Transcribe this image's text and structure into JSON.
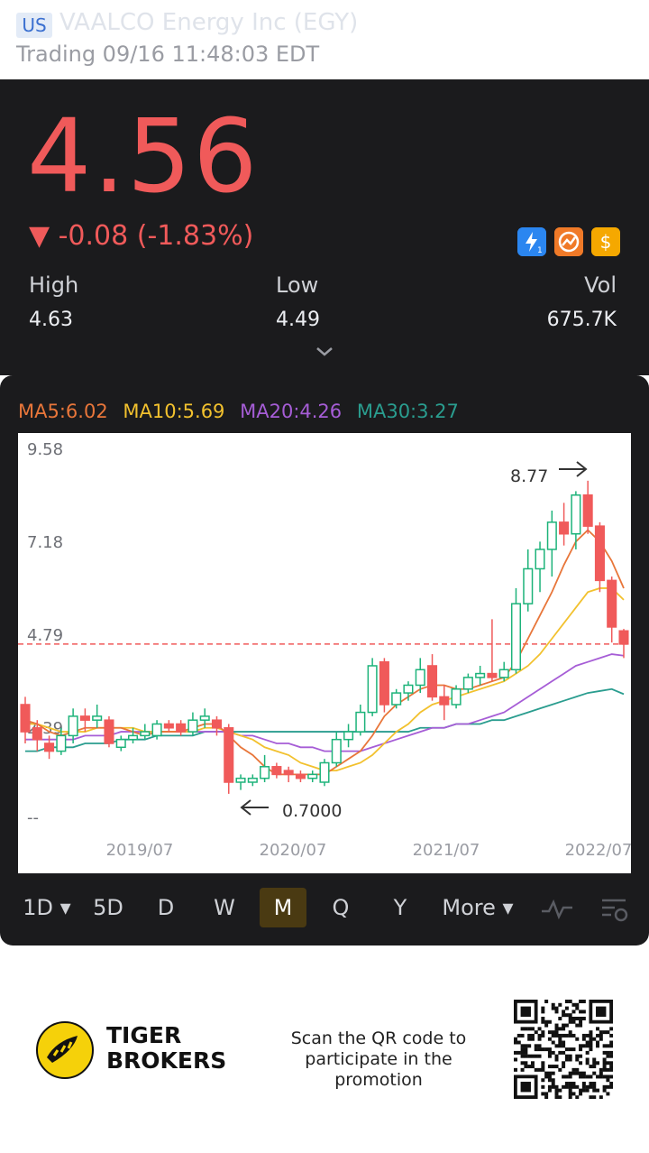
{
  "header": {
    "market_badge": "US",
    "title": "VAALCO Energy Inc (EGY)",
    "status": "Trading 09/16 11:48:03 EDT"
  },
  "quote": {
    "price": "4.56",
    "change": "▼ -0.08 (-1.83%)",
    "high_label": "High",
    "high_value": "4.63",
    "low_label": "Low",
    "low_value": "4.49",
    "vol_label": "Vol",
    "vol_value": "675.7K",
    "colors": {
      "down": "#f05a5a",
      "up": "#1db37a"
    }
  },
  "moving_averages": {
    "ma5": "MA5:6.02",
    "ma10": "MA10:5.69",
    "ma20": "MA20:4.26",
    "ma30": "MA30:3.27",
    "colors": {
      "ma5": "#e8763a",
      "ma10": "#f2c12e",
      "ma20": "#a65dd6",
      "ma30": "#2a9d8f"
    }
  },
  "chart_data": {
    "type": "candlestick",
    "y_ticks": [
      "9.58",
      "7.18",
      "4.79",
      "2.39",
      "--"
    ],
    "x_ticks": [
      "2019/07",
      "2020/07",
      "2021/07",
      "2022/07"
    ],
    "ylim": [
      0.0,
      9.58
    ],
    "current_price_line": 4.56,
    "annotations": {
      "high_label": "8.77",
      "low_label": "0.7000"
    },
    "candles": [
      {
        "o": 3.0,
        "h": 3.2,
        "l": 2.0,
        "c": 2.3
      },
      {
        "o": 2.4,
        "h": 2.6,
        "l": 1.8,
        "c": 2.1
      },
      {
        "o": 2.0,
        "h": 2.2,
        "l": 1.6,
        "c": 1.8
      },
      {
        "o": 1.8,
        "h": 2.4,
        "l": 1.7,
        "c": 2.2
      },
      {
        "o": 2.2,
        "h": 2.9,
        "l": 2.0,
        "c": 2.7
      },
      {
        "o": 2.7,
        "h": 2.9,
        "l": 2.3,
        "c": 2.6
      },
      {
        "o": 2.6,
        "h": 3.0,
        "l": 2.4,
        "c": 2.7
      },
      {
        "o": 2.6,
        "h": 2.7,
        "l": 1.9,
        "c": 2.0
      },
      {
        "o": 1.9,
        "h": 2.2,
        "l": 1.8,
        "c": 2.1
      },
      {
        "o": 2.1,
        "h": 2.4,
        "l": 2.0,
        "c": 2.2
      },
      {
        "o": 2.2,
        "h": 2.5,
        "l": 2.1,
        "c": 2.3
      },
      {
        "o": 2.2,
        "h": 2.6,
        "l": 2.1,
        "c": 2.5
      },
      {
        "o": 2.5,
        "h": 2.6,
        "l": 2.3,
        "c": 2.4
      },
      {
        "o": 2.5,
        "h": 2.6,
        "l": 2.2,
        "c": 2.3
      },
      {
        "o": 2.3,
        "h": 2.8,
        "l": 2.2,
        "c": 2.6
      },
      {
        "o": 2.6,
        "h": 2.9,
        "l": 2.4,
        "c": 2.7
      },
      {
        "o": 2.6,
        "h": 2.7,
        "l": 2.2,
        "c": 2.4
      },
      {
        "o": 2.4,
        "h": 2.5,
        "l": 0.7,
        "c": 1.0
      },
      {
        "o": 1.0,
        "h": 1.2,
        "l": 0.8,
        "c": 1.1
      },
      {
        "o": 1.0,
        "h": 1.2,
        "l": 0.9,
        "c": 1.1
      },
      {
        "o": 1.1,
        "h": 1.7,
        "l": 1.0,
        "c": 1.4
      },
      {
        "o": 1.4,
        "h": 1.5,
        "l": 1.1,
        "c": 1.2
      },
      {
        "o": 1.3,
        "h": 1.4,
        "l": 1.0,
        "c": 1.2
      },
      {
        "o": 1.2,
        "h": 1.3,
        "l": 1.0,
        "c": 1.1
      },
      {
        "o": 1.1,
        "h": 1.3,
        "l": 1.0,
        "c": 1.2
      },
      {
        "o": 1.0,
        "h": 1.6,
        "l": 0.9,
        "c": 1.5
      },
      {
        "o": 1.5,
        "h": 2.3,
        "l": 1.4,
        "c": 2.1
      },
      {
        "o": 2.1,
        "h": 2.5,
        "l": 1.9,
        "c": 2.3
      },
      {
        "o": 2.3,
        "h": 3.0,
        "l": 2.2,
        "c": 2.8
      },
      {
        "o": 2.8,
        "h": 4.2,
        "l": 2.7,
        "c": 4.0
      },
      {
        "o": 4.1,
        "h": 4.2,
        "l": 2.8,
        "c": 3.0
      },
      {
        "o": 3.0,
        "h": 3.4,
        "l": 2.9,
        "c": 3.3
      },
      {
        "o": 3.3,
        "h": 3.6,
        "l": 3.1,
        "c": 3.5
      },
      {
        "o": 3.5,
        "h": 4.2,
        "l": 3.3,
        "c": 3.9
      },
      {
        "o": 4.0,
        "h": 4.3,
        "l": 3.1,
        "c": 3.2
      },
      {
        "o": 3.2,
        "h": 3.5,
        "l": 2.6,
        "c": 3.0
      },
      {
        "o": 3.0,
        "h": 3.5,
        "l": 2.9,
        "c": 3.4
      },
      {
        "o": 3.4,
        "h": 3.8,
        "l": 3.3,
        "c": 3.7
      },
      {
        "o": 3.7,
        "h": 4.0,
        "l": 3.5,
        "c": 3.8
      },
      {
        "o": 3.8,
        "h": 5.2,
        "l": 3.6,
        "c": 3.7
      },
      {
        "o": 3.7,
        "h": 4.1,
        "l": 3.6,
        "c": 3.9
      },
      {
        "o": 3.9,
        "h": 6.0,
        "l": 3.8,
        "c": 5.6
      },
      {
        "o": 5.6,
        "h": 7.0,
        "l": 5.4,
        "c": 6.5
      },
      {
        "o": 6.5,
        "h": 7.2,
        "l": 5.9,
        "c": 7.0
      },
      {
        "o": 7.0,
        "h": 8.0,
        "l": 6.3,
        "c": 7.7
      },
      {
        "o": 7.7,
        "h": 8.2,
        "l": 7.1,
        "c": 7.4
      },
      {
        "o": 7.4,
        "h": 8.5,
        "l": 7.0,
        "c": 8.4
      },
      {
        "o": 8.4,
        "h": 8.77,
        "l": 7.4,
        "c": 7.6
      },
      {
        "o": 7.6,
        "h": 7.7,
        "l": 5.9,
        "c": 6.2
      },
      {
        "o": 6.2,
        "h": 6.3,
        "l": 4.6,
        "c": 5.0
      },
      {
        "o": 4.9,
        "h": 4.95,
        "l": 4.2,
        "c": 4.56
      }
    ],
    "ma5_values": [
      2.6,
      2.5,
      2.3,
      2.2,
      2.3,
      2.4,
      2.4,
      2.4,
      2.4,
      2.3,
      2.2,
      2.3,
      2.3,
      2.3,
      2.4,
      2.5,
      2.5,
      2.2,
      1.9,
      1.7,
      1.4,
      1.2,
      1.2,
      1.2,
      1.2,
      1.2,
      1.4,
      1.6,
      1.8,
      2.2,
      2.7,
      3.0,
      3.2,
      3.4,
      3.5,
      3.5,
      3.4,
      3.4,
      3.5,
      3.6,
      3.7,
      4.1,
      4.7,
      5.3,
      5.9,
      6.6,
      7.2,
      7.5,
      7.2,
      6.7,
      6.0
    ],
    "ma10_values": [
      2.5,
      2.5,
      2.4,
      2.3,
      2.3,
      2.3,
      2.4,
      2.4,
      2.4,
      2.4,
      2.3,
      2.3,
      2.3,
      2.3,
      2.3,
      2.4,
      2.4,
      2.3,
      2.2,
      2.1,
      1.9,
      1.8,
      1.7,
      1.5,
      1.4,
      1.3,
      1.3,
      1.4,
      1.5,
      1.7,
      2.0,
      2.3,
      2.5,
      2.8,
      3.0,
      3.1,
      3.2,
      3.3,
      3.4,
      3.5,
      3.6,
      3.8,
      4.0,
      4.3,
      4.7,
      5.1,
      5.5,
      5.9,
      6.0,
      6.0,
      5.7
    ],
    "ma20_values": [
      2.1,
      2.1,
      2.1,
      2.1,
      2.1,
      2.2,
      2.2,
      2.2,
      2.3,
      2.3,
      2.3,
      2.3,
      2.3,
      2.3,
      2.3,
      2.3,
      2.3,
      2.3,
      2.2,
      2.2,
      2.1,
      2.0,
      2.0,
      1.9,
      1.9,
      1.8,
      1.8,
      1.8,
      1.8,
      1.9,
      2.0,
      2.1,
      2.2,
      2.3,
      2.4,
      2.4,
      2.5,
      2.5,
      2.6,
      2.7,
      2.8,
      3.0,
      3.2,
      3.4,
      3.6,
      3.8,
      4.0,
      4.1,
      4.2,
      4.3,
      4.26
    ],
    "ma30_values": [
      1.8,
      1.8,
      1.9,
      1.9,
      1.9,
      2.0,
      2.0,
      2.0,
      2.1,
      2.1,
      2.1,
      2.2,
      2.2,
      2.2,
      2.2,
      2.3,
      2.3,
      2.3,
      2.3,
      2.3,
      2.3,
      2.3,
      2.3,
      2.3,
      2.3,
      2.3,
      2.3,
      2.3,
      2.3,
      2.3,
      2.3,
      2.3,
      2.3,
      2.4,
      2.4,
      2.4,
      2.5,
      2.5,
      2.5,
      2.6,
      2.6,
      2.7,
      2.8,
      2.9,
      3.0,
      3.1,
      3.2,
      3.3,
      3.35,
      3.4,
      3.27
    ]
  },
  "periods": {
    "items": [
      {
        "label": "1D ▾",
        "active": false
      },
      {
        "label": "5D",
        "active": false
      },
      {
        "label": "D",
        "active": false
      },
      {
        "label": "W",
        "active": false
      },
      {
        "label": "M",
        "active": true
      },
      {
        "label": "Q",
        "active": false
      },
      {
        "label": "Y",
        "active": false
      },
      {
        "label": "More ▾",
        "active": false
      }
    ]
  },
  "footer": {
    "brand_line1": "TIGER",
    "brand_line2": "BROKERS",
    "promo_line1": "Scan the QR code to",
    "promo_line2": "participate in the promotion"
  }
}
